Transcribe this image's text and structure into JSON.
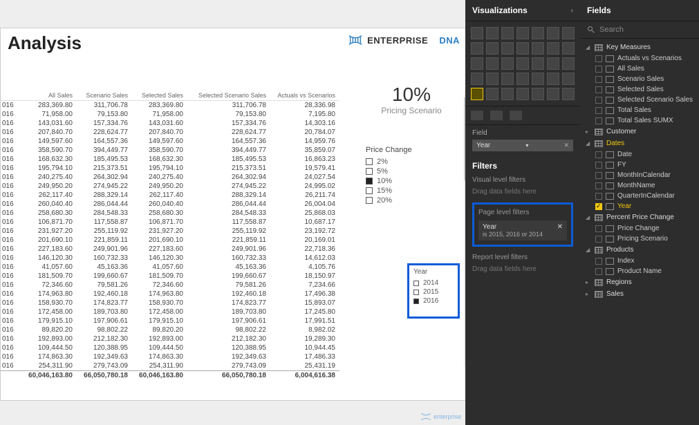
{
  "report": {
    "title": "Analysis",
    "logo_main": "ENTERPRISE",
    "logo_accent": "DNA"
  },
  "chart_data": {
    "type": "table",
    "columns": [
      "",
      "All Sales",
      "Scenario Sales",
      "Selected Sales",
      "Selected Scenario Sales",
      "Actuals vs Scenarios"
    ],
    "rows": [
      [
        "016",
        "283,369.80",
        "311,706.78",
        "283,369.80",
        "311,706.78",
        "28,336.98"
      ],
      [
        "016",
        "71,958.00",
        "79,153.80",
        "71,958.00",
        "79,153.80",
        "7,195.80"
      ],
      [
        "016",
        "143,031.60",
        "157,334.76",
        "143,031.60",
        "157,334.76",
        "14,303.16"
      ],
      [
        "016",
        "207,840.70",
        "228,624.77",
        "207,840.70",
        "228,624.77",
        "20,784.07"
      ],
      [
        "016",
        "149,597.60",
        "164,557.36",
        "149,597.60",
        "164,557.36",
        "14,959.76"
      ],
      [
        "016",
        "358,590.70",
        "394,449.77",
        "358,590.70",
        "394,449.77",
        "35,859.07"
      ],
      [
        "016",
        "168,632.30",
        "185,495.53",
        "168,632.30",
        "185,495.53",
        "16,863.23"
      ],
      [
        "016",
        "195,794.10",
        "215,373.51",
        "195,794.10",
        "215,373.51",
        "19,579.41"
      ],
      [
        "016",
        "240,275.40",
        "264,302.94",
        "240,275.40",
        "264,302.94",
        "24,027.54"
      ],
      [
        "016",
        "249,950.20",
        "274,945.22",
        "249,950.20",
        "274,945.22",
        "24,995.02"
      ],
      [
        "016",
        "262,117.40",
        "288,329.14",
        "262,117.40",
        "288,329.14",
        "26,211.74"
      ],
      [
        "016",
        "260,040.40",
        "286,044.44",
        "260,040.40",
        "286,044.44",
        "26,004.04"
      ],
      [
        "016",
        "258,680.30",
        "284,548.33",
        "258,680.30",
        "284,548.33",
        "25,868.03"
      ],
      [
        "016",
        "106,871.70",
        "117,558.87",
        "106,871.70",
        "117,558.87",
        "10,687.17"
      ],
      [
        "016",
        "231,927.20",
        "255,119.92",
        "231,927.20",
        "255,119.92",
        "23,192.72"
      ],
      [
        "016",
        "201,690.10",
        "221,859.11",
        "201,690.10",
        "221,859.11",
        "20,169.01"
      ],
      [
        "016",
        "227,183.60",
        "249,901.96",
        "227,183.60",
        "249,901.96",
        "22,718.36"
      ],
      [
        "016",
        "146,120.30",
        "160,732.33",
        "146,120.30",
        "160,732.33",
        "14,612.03"
      ],
      [
        "016",
        "41,057.60",
        "45,163.36",
        "41,057.60",
        "45,163.36",
        "4,105.76"
      ],
      [
        "016",
        "181,509.70",
        "199,660.67",
        "181,509.70",
        "199,660.67",
        "18,150.97"
      ],
      [
        "016",
        "72,346.60",
        "79,581.26",
        "72,346.60",
        "79,581.26",
        "7,234.66"
      ],
      [
        "016",
        "174,963.80",
        "192,460.18",
        "174,963.80",
        "192,460.18",
        "17,496.38"
      ],
      [
        "016",
        "158,930.70",
        "174,823.77",
        "158,930.70",
        "174,823.77",
        "15,893.07"
      ],
      [
        "016",
        "172,458.00",
        "189,703.80",
        "172,458.00",
        "189,703.80",
        "17,245.80"
      ],
      [
        "016",
        "179,915.10",
        "197,906.61",
        "179,915.10",
        "197,906.61",
        "17,991.51"
      ],
      [
        "016",
        "89,820.20",
        "98,802.22",
        "89,820.20",
        "98,802.22",
        "8,982.02"
      ],
      [
        "016",
        "192,893.00",
        "212,182.30",
        "192,893.00",
        "212,182.30",
        "19,289.30"
      ],
      [
        "016",
        "109,444.50",
        "120,388.95",
        "109,444.50",
        "120,388.95",
        "10,944.45"
      ],
      [
        "016",
        "174,863.30",
        "192,349.63",
        "174,863.30",
        "192,349.63",
        "17,486.33"
      ],
      [
        "016",
        "254,311.90",
        "279,743.09",
        "254,311.90",
        "279,743.09",
        "25,431.19"
      ]
    ],
    "totals": [
      "",
      "60,046,163.80",
      "66,050,780.18",
      "60,046,163.80",
      "66,050,780.18",
      "6,004,616.38"
    ]
  },
  "scenario": {
    "value": "10%",
    "label": "Pricing Scenario"
  },
  "price_change": {
    "title": "Price Change",
    "options": [
      {
        "label": "2%",
        "checked": false
      },
      {
        "label": "5%",
        "checked": false
      },
      {
        "label": "10%",
        "checked": true
      },
      {
        "label": "15%",
        "checked": false
      },
      {
        "label": "20%",
        "checked": false
      }
    ]
  },
  "slicer": {
    "title": "Year",
    "options": [
      {
        "label": "2014",
        "checked": false
      },
      {
        "label": "2015",
        "checked": false
      },
      {
        "label": "2016",
        "checked": true
      }
    ]
  },
  "viz_panel": {
    "title": "Visualizations",
    "field_label": "Field",
    "field_value": "Year",
    "filters_title": "Filters",
    "visual_filters_label": "Visual level filters",
    "drag_hint": "Drag data fields here",
    "page_filters_label": "Page level filters",
    "page_filter_name": "Year",
    "page_filter_desc": "is 2015, 2016 or 2014",
    "report_filters_label": "Report level filters"
  },
  "fields_panel": {
    "title": "Fields",
    "search_placeholder": "Search",
    "tables": [
      {
        "name": "Key Measures",
        "expanded": true,
        "highlight": false,
        "items": [
          {
            "name": "Actuals vs Scenarios",
            "checked": false
          },
          {
            "name": "All Sales",
            "checked": false
          },
          {
            "name": "Scenario Sales",
            "checked": false
          },
          {
            "name": "Selected Sales",
            "checked": false
          },
          {
            "name": "Selected Scenario Sales",
            "checked": false
          },
          {
            "name": "Total Sales",
            "checked": false
          },
          {
            "name": "Total Sales SUMX",
            "checked": false
          }
        ]
      },
      {
        "name": "Customer",
        "expanded": false,
        "highlight": false,
        "items": []
      },
      {
        "name": "Dates",
        "expanded": true,
        "highlight": true,
        "items": [
          {
            "name": "Date",
            "checked": false
          },
          {
            "name": "FY",
            "checked": false
          },
          {
            "name": "MonthInCalendar",
            "checked": false
          },
          {
            "name": "MonthName",
            "checked": false
          },
          {
            "name": "QuarterInCalendar",
            "checked": false
          },
          {
            "name": "Year",
            "checked": true,
            "highlight": true
          }
        ]
      },
      {
        "name": "Percent Price Change",
        "expanded": true,
        "highlight": false,
        "items": [
          {
            "name": "Price Change",
            "checked": false
          },
          {
            "name": "Pricing Scenario",
            "checked": false
          }
        ]
      },
      {
        "name": "Products",
        "expanded": true,
        "highlight": false,
        "items": [
          {
            "name": "Index",
            "checked": false
          },
          {
            "name": "Product Name",
            "checked": false
          }
        ]
      },
      {
        "name": "Regions",
        "expanded": false,
        "highlight": false,
        "items": []
      },
      {
        "name": "Sales",
        "expanded": false,
        "highlight": false,
        "items": []
      }
    ]
  },
  "watermark": "enterprise"
}
